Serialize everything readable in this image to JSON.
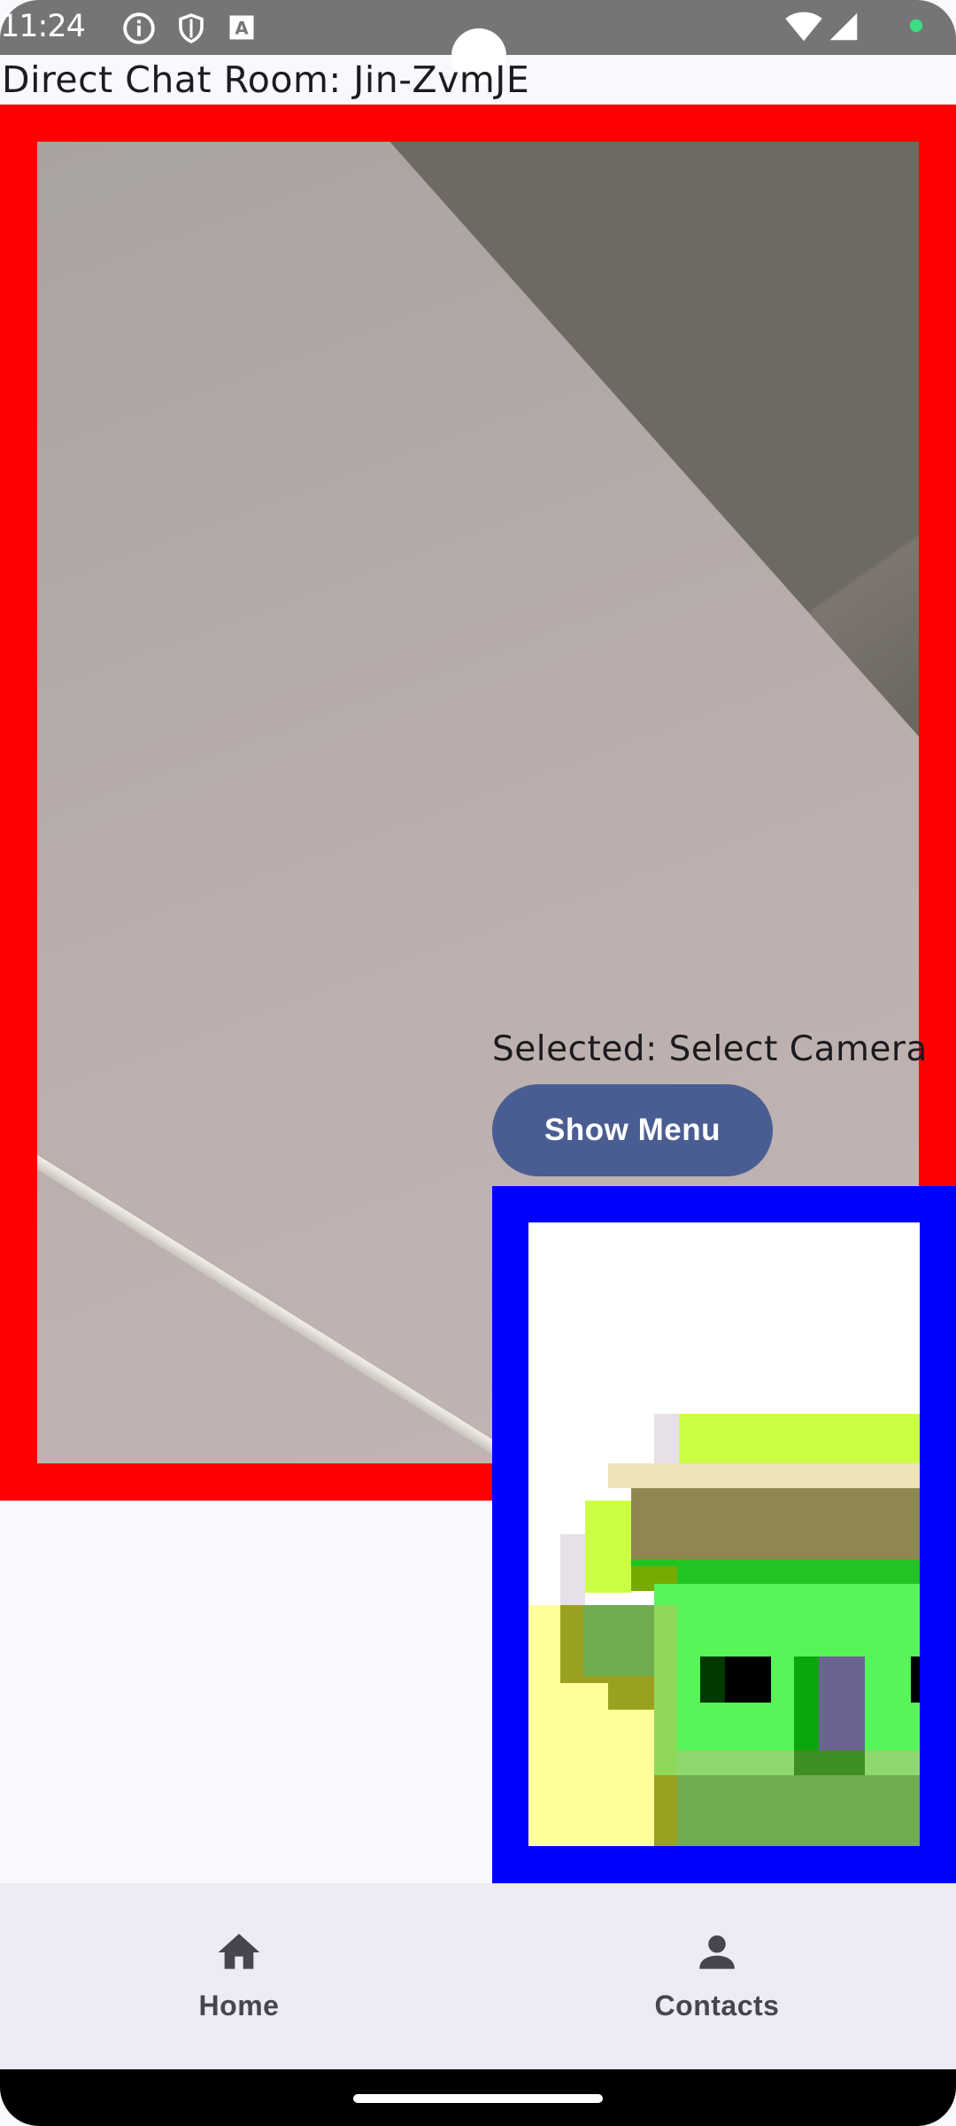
{
  "status_bar": {
    "time": "11:24",
    "icons": [
      "info-icon",
      "shield-icon",
      "a-badge-icon",
      "wifi-icon",
      "signal-icon",
      "dot-icon"
    ]
  },
  "chat": {
    "title": "Direct Chat Room: Jin-ZvmJE"
  },
  "camera": {
    "selected_label": "Selected: Select Camera",
    "menu_button": "Show Menu"
  },
  "colors": {
    "remote_border": "#ff0000",
    "local_border": "#0000ff",
    "button": "#4a5d93",
    "nav_background": "#edebf3"
  },
  "bottom_nav": {
    "items": [
      {
        "label": "Home",
        "icon": "home-icon"
      },
      {
        "label": "Contacts",
        "icon": "person-icon"
      }
    ]
  }
}
